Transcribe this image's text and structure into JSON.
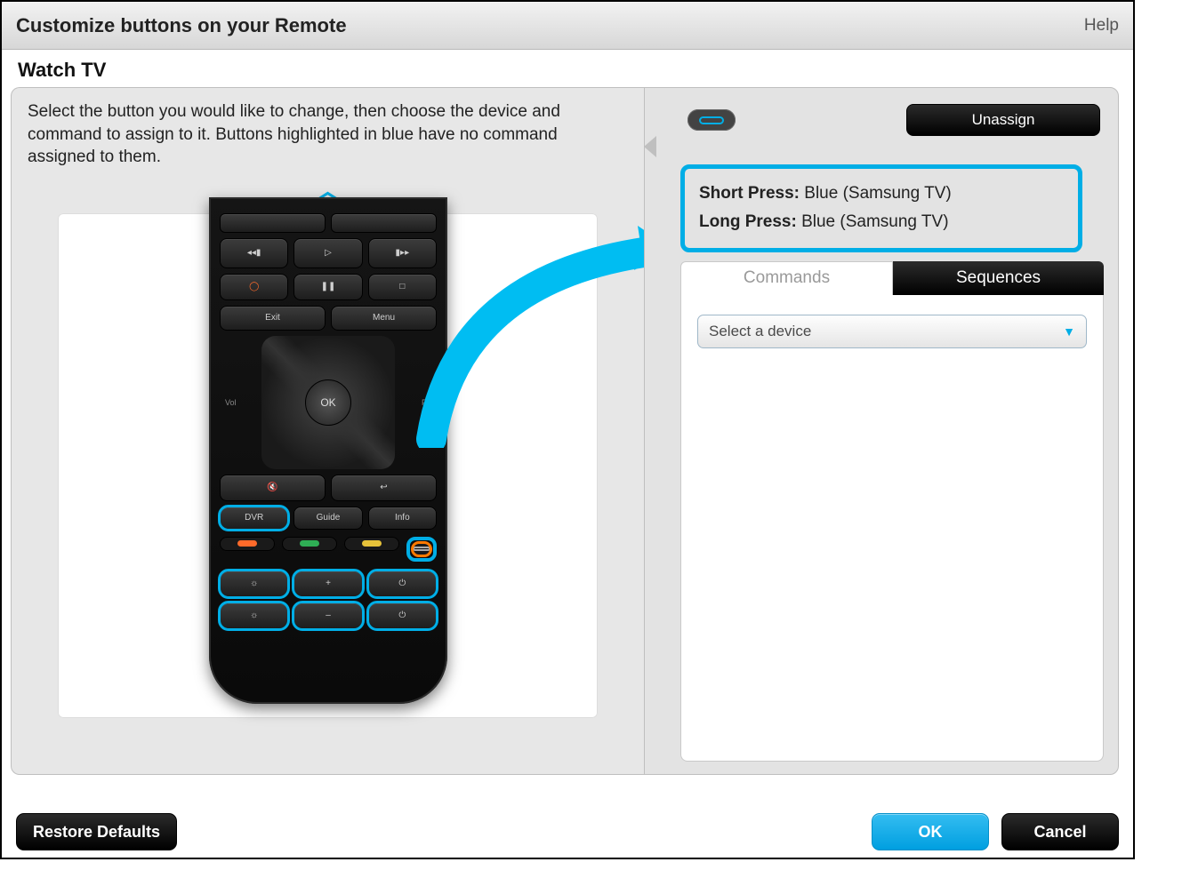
{
  "titlebar": {
    "title": "Customize buttons on your Remote",
    "help": "Help"
  },
  "subheader": "Watch TV",
  "instructions": "Select the button you would like to change, then choose the device and command to assign to it. Buttons highlighted in blue have no command assigned to them.",
  "remote": {
    "ok": "OK",
    "exit": "Exit",
    "menu": "Menu",
    "dvr": "DVR",
    "guide": "Guide",
    "info": "Info",
    "vol": "Vol",
    "pg": "Pg",
    "rec_symbol": "◯",
    "play_symbol": "▷",
    "pause_symbol": "❚❚",
    "stop_symbol": "□",
    "rew_symbol": "◂◂▮",
    "ff_symbol": "▮▸▸",
    "mute_symbol": "🔇",
    "back_symbol": "↩",
    "bulb_symbol": "☼",
    "plus": "+",
    "minus": "–",
    "plug_symbol": "⏻"
  },
  "right": {
    "unassign": "Unassign",
    "short_label": "Short Press:",
    "short_value": "Blue (Samsung TV)",
    "long_label": "Long Press:",
    "long_value": "Blue (Samsung TV)",
    "tab_commands": "Commands",
    "tab_sequences": "Sequences",
    "select_placeholder": "Select a device"
  },
  "footer": {
    "restore": "Restore Defaults",
    "ok": "OK",
    "cancel": "Cancel"
  },
  "colors": {
    "highlight": "#00aee6",
    "selected": "#ff7a00",
    "pill_red": "#ff6a2a",
    "pill_green": "#2fae55",
    "pill_yellow": "#e6c23a",
    "pill_blue_border": "#00aee6"
  }
}
